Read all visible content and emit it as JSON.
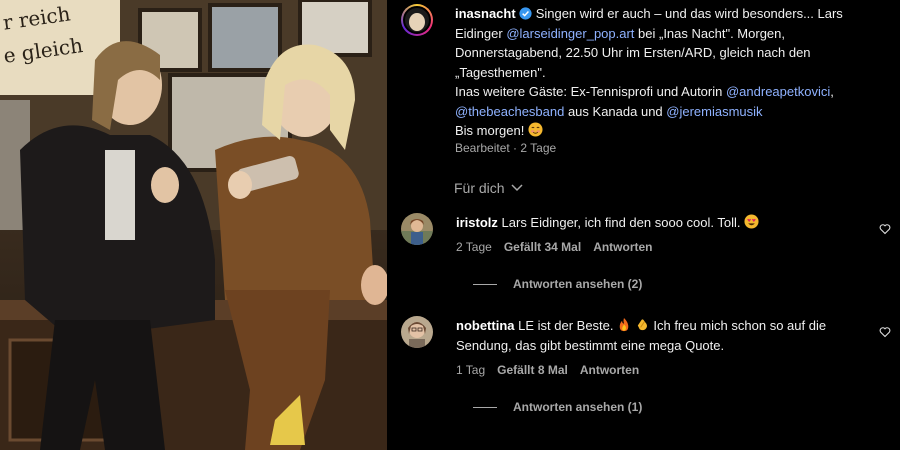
{
  "post": {
    "username": "inasnacht",
    "avatar_icon": "profile-avatar",
    "caption_parts": {
      "p1": "Singen wird er auch – und das wird besonders... Lars Eidinger ",
      "m1": "@larseidinger_pop.art",
      "p2": " bei „Inas Nacht\". Morgen, Donnerstagabend, 22.50 Uhr im Ersten/ARD, gleich nach den „Tagesthemen\".",
      "p3": "Inas weitere Gäste: Ex-Tennisprofi und Autorin ",
      "m2": "@andreapetkovici",
      "p4": ",",
      "m3": "@thebeachesband",
      "p5": " aus Kanada und ",
      "m4": "@jeremiasmusik",
      "p6": "Bis morgen! "
    },
    "edited_label": "Bearbeitet · 2 Tage"
  },
  "filter": {
    "label": "Für dich"
  },
  "comments": [
    {
      "username": "iristolz",
      "text": "Lars Eidinger, ich find den sooo cool. Toll. ",
      "time": "2 Tage",
      "likes": "Gefällt 34 Mal",
      "reply": "Antworten",
      "view_replies": "Antworten ansehen (2)"
    },
    {
      "username": "nobettina",
      "text": "LE ist der Beste. ",
      "text2": " Ich freu mich schon so auf die Sendung, das gibt bestimmt eine mega Quote.",
      "time": "1 Tag",
      "likes": "Gefällt 8 Mal",
      "reply": "Antworten",
      "view_replies": "Antworten ansehen (1)"
    }
  ],
  "colors": {
    "mention": "#8fb2ff",
    "muted": "#a8a8a8",
    "verified": "#3897f0"
  }
}
